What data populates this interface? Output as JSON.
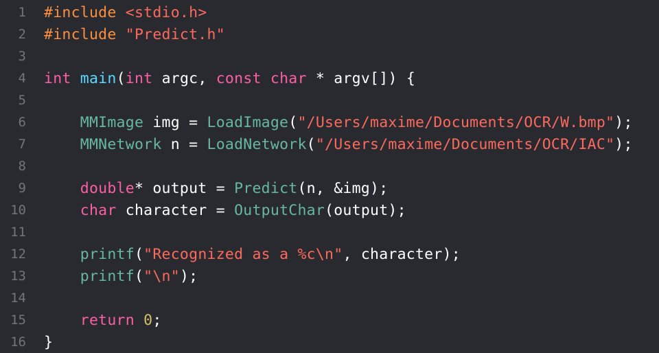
{
  "colors": {
    "background": "#292a30",
    "line_number": "#747478",
    "plain": "#ffffff",
    "preprocessor": "#fd8f3f",
    "string": "#fc6a5d",
    "keyword": "#fc5fa3",
    "function": "#67b7a4",
    "declaration": "#5dd8ff",
    "number": "#d0bf69"
  },
  "lines": [
    {
      "n": "1",
      "tokens": [
        [
          "pp",
          "#include "
        ],
        [
          "str",
          "<stdio.h>"
        ]
      ]
    },
    {
      "n": "2",
      "tokens": [
        [
          "pp",
          "#include "
        ],
        [
          "str",
          "\"Predict.h\""
        ]
      ]
    },
    {
      "n": "3",
      "tokens": []
    },
    {
      "n": "4",
      "tokens": [
        [
          "kw",
          "int"
        ],
        [
          "pl",
          " "
        ],
        [
          "dfn",
          "main"
        ],
        [
          "pl",
          "("
        ],
        [
          "kw",
          "int"
        ],
        [
          "pl",
          " argc, "
        ],
        [
          "kw",
          "const"
        ],
        [
          "pl",
          " "
        ],
        [
          "kw",
          "char"
        ],
        [
          "pl",
          " * argv[]) {"
        ]
      ]
    },
    {
      "n": "5",
      "tokens": []
    },
    {
      "n": "6",
      "tokens": [
        [
          "pl",
          "    "
        ],
        [
          "fn",
          "MMImage"
        ],
        [
          "pl",
          " img = "
        ],
        [
          "fn",
          "LoadImage"
        ],
        [
          "pl",
          "("
        ],
        [
          "str",
          "\"/Users/maxime/Documents/OCR/W.bmp\""
        ],
        [
          "pl",
          ");"
        ]
      ]
    },
    {
      "n": "7",
      "tokens": [
        [
          "pl",
          "    "
        ],
        [
          "fn",
          "MMNetwork"
        ],
        [
          "pl",
          " n = "
        ],
        [
          "fn",
          "LoadNetwork"
        ],
        [
          "pl",
          "("
        ],
        [
          "str",
          "\"/Users/maxime/Documents/OCR/IAC\""
        ],
        [
          "pl",
          ");"
        ]
      ]
    },
    {
      "n": "8",
      "tokens": []
    },
    {
      "n": "9",
      "tokens": [
        [
          "pl",
          "    "
        ],
        [
          "kw",
          "double"
        ],
        [
          "pl",
          "* output = "
        ],
        [
          "fn",
          "Predict"
        ],
        [
          "pl",
          "(n, &img);"
        ]
      ]
    },
    {
      "n": "10",
      "tokens": [
        [
          "pl",
          "    "
        ],
        [
          "kw",
          "char"
        ],
        [
          "pl",
          " character = "
        ],
        [
          "fn",
          "OutputChar"
        ],
        [
          "pl",
          "(output);"
        ]
      ]
    },
    {
      "n": "11",
      "tokens": []
    },
    {
      "n": "12",
      "tokens": [
        [
          "pl",
          "    "
        ],
        [
          "fn",
          "printf"
        ],
        [
          "pl",
          "("
        ],
        [
          "str",
          "\"Recognized as a %c\\n\""
        ],
        [
          "pl",
          ", character);"
        ]
      ]
    },
    {
      "n": "13",
      "tokens": [
        [
          "pl",
          "    "
        ],
        [
          "fn",
          "printf"
        ],
        [
          "pl",
          "("
        ],
        [
          "str",
          "\"\\n\""
        ],
        [
          "pl",
          ");"
        ]
      ]
    },
    {
      "n": "14",
      "tokens": []
    },
    {
      "n": "15",
      "tokens": [
        [
          "pl",
          "    "
        ],
        [
          "kw",
          "return"
        ],
        [
          "pl",
          " "
        ],
        [
          "num",
          "0"
        ],
        [
          "pl",
          ";"
        ]
      ]
    },
    {
      "n": "16",
      "tokens": [
        [
          "pl",
          "}"
        ]
      ]
    }
  ]
}
